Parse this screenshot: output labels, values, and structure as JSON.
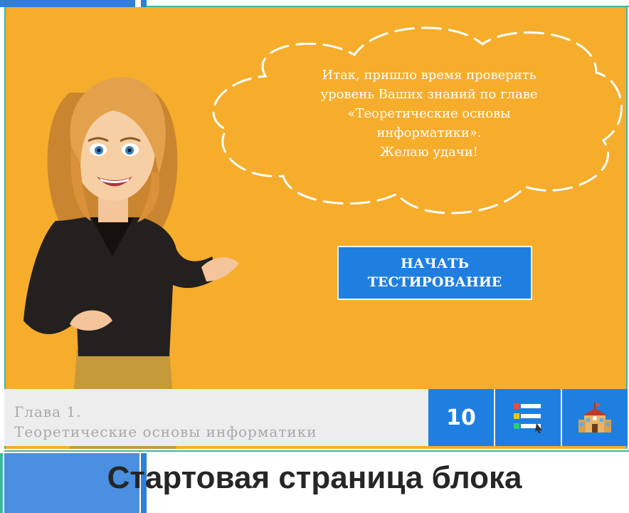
{
  "speech_bubble": {
    "lines": [
      "Итак, пришло время проверить",
      "уровень Ваших знаний по главе",
      "«Теоретические основы",
      "информатики».",
      "Желаю удачи!"
    ]
  },
  "start_button": {
    "line1": "НАЧАТЬ",
    "line2": "ТЕСТИРОВАНИЕ"
  },
  "footer": {
    "chapter_number": "Глава 1.",
    "chapter_title": "Теоретические основы информатики",
    "question_count": "10",
    "list_icon": "questions-list-icon",
    "school_icon": "school-icon"
  },
  "page": {
    "title": "Стартовая страница блока"
  },
  "colors": {
    "background": "#f6ad2b",
    "accent_blue": "#1f7fe0",
    "teal": "#3bb9a0"
  }
}
